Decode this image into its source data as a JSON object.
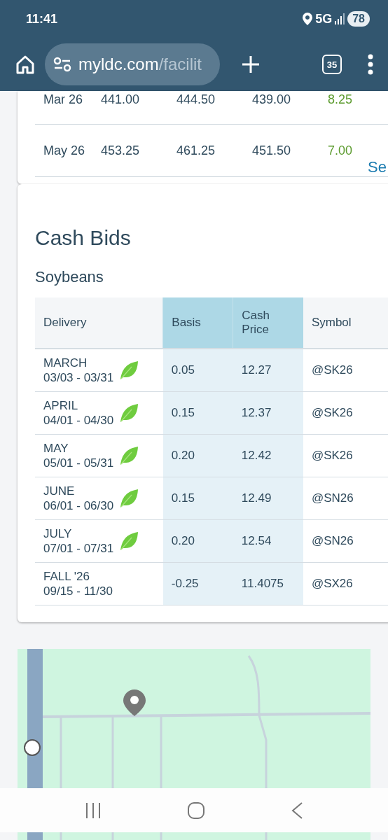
{
  "status_bar": {
    "time": "11:41",
    "network": "5G",
    "battery": "78"
  },
  "browser": {
    "url_host": "myldc.com",
    "url_path": "/facilit",
    "tab_count": "35"
  },
  "futures": {
    "rows": [
      {
        "month": "Mar 26",
        "column_2": "441.00",
        "column_3": "444.50",
        "column_4": "439.00",
        "column_5": "8.25"
      },
      {
        "month": "May 26",
        "column_2": "453.25",
        "column_3": "461.25",
        "column_4": "451.50",
        "column_5": "7.00"
      }
    ],
    "link": "Se"
  },
  "cash_bids": {
    "title": "Cash Bids",
    "commodity": "Soybeans",
    "columns": [
      "Delivery",
      "Basis",
      "Cash Price",
      "Symbol"
    ],
    "rows": [
      {
        "period": "MARCH",
        "dates": "03/03 - 03/31",
        "leaf": true,
        "basis": "0.05",
        "cash_price": "12.27",
        "symbol": "@SK26"
      },
      {
        "period": "APRIL",
        "dates": "04/01 - 04/30",
        "leaf": true,
        "basis": "0.15",
        "cash_price": "12.37",
        "symbol": "@SK26"
      },
      {
        "period": "MAY",
        "dates": "05/01 - 05/31",
        "leaf": true,
        "basis": "0.20",
        "cash_price": "12.42",
        "symbol": "@SK26"
      },
      {
        "period": "JUNE",
        "dates": "06/01 - 06/30",
        "leaf": true,
        "basis": "0.15",
        "cash_price": "12.49",
        "symbol": "@SN26"
      },
      {
        "period": "JULY",
        "dates": "07/01 - 07/31",
        "leaf": true,
        "basis": "0.20",
        "cash_price": "12.54",
        "symbol": "@SN26"
      },
      {
        "period": "FALL '26",
        "dates": "09/15 - 11/30",
        "leaf": false,
        "basis": "-0.25",
        "cash_price": "11.4075",
        "symbol": "@SX26"
      }
    ]
  }
}
